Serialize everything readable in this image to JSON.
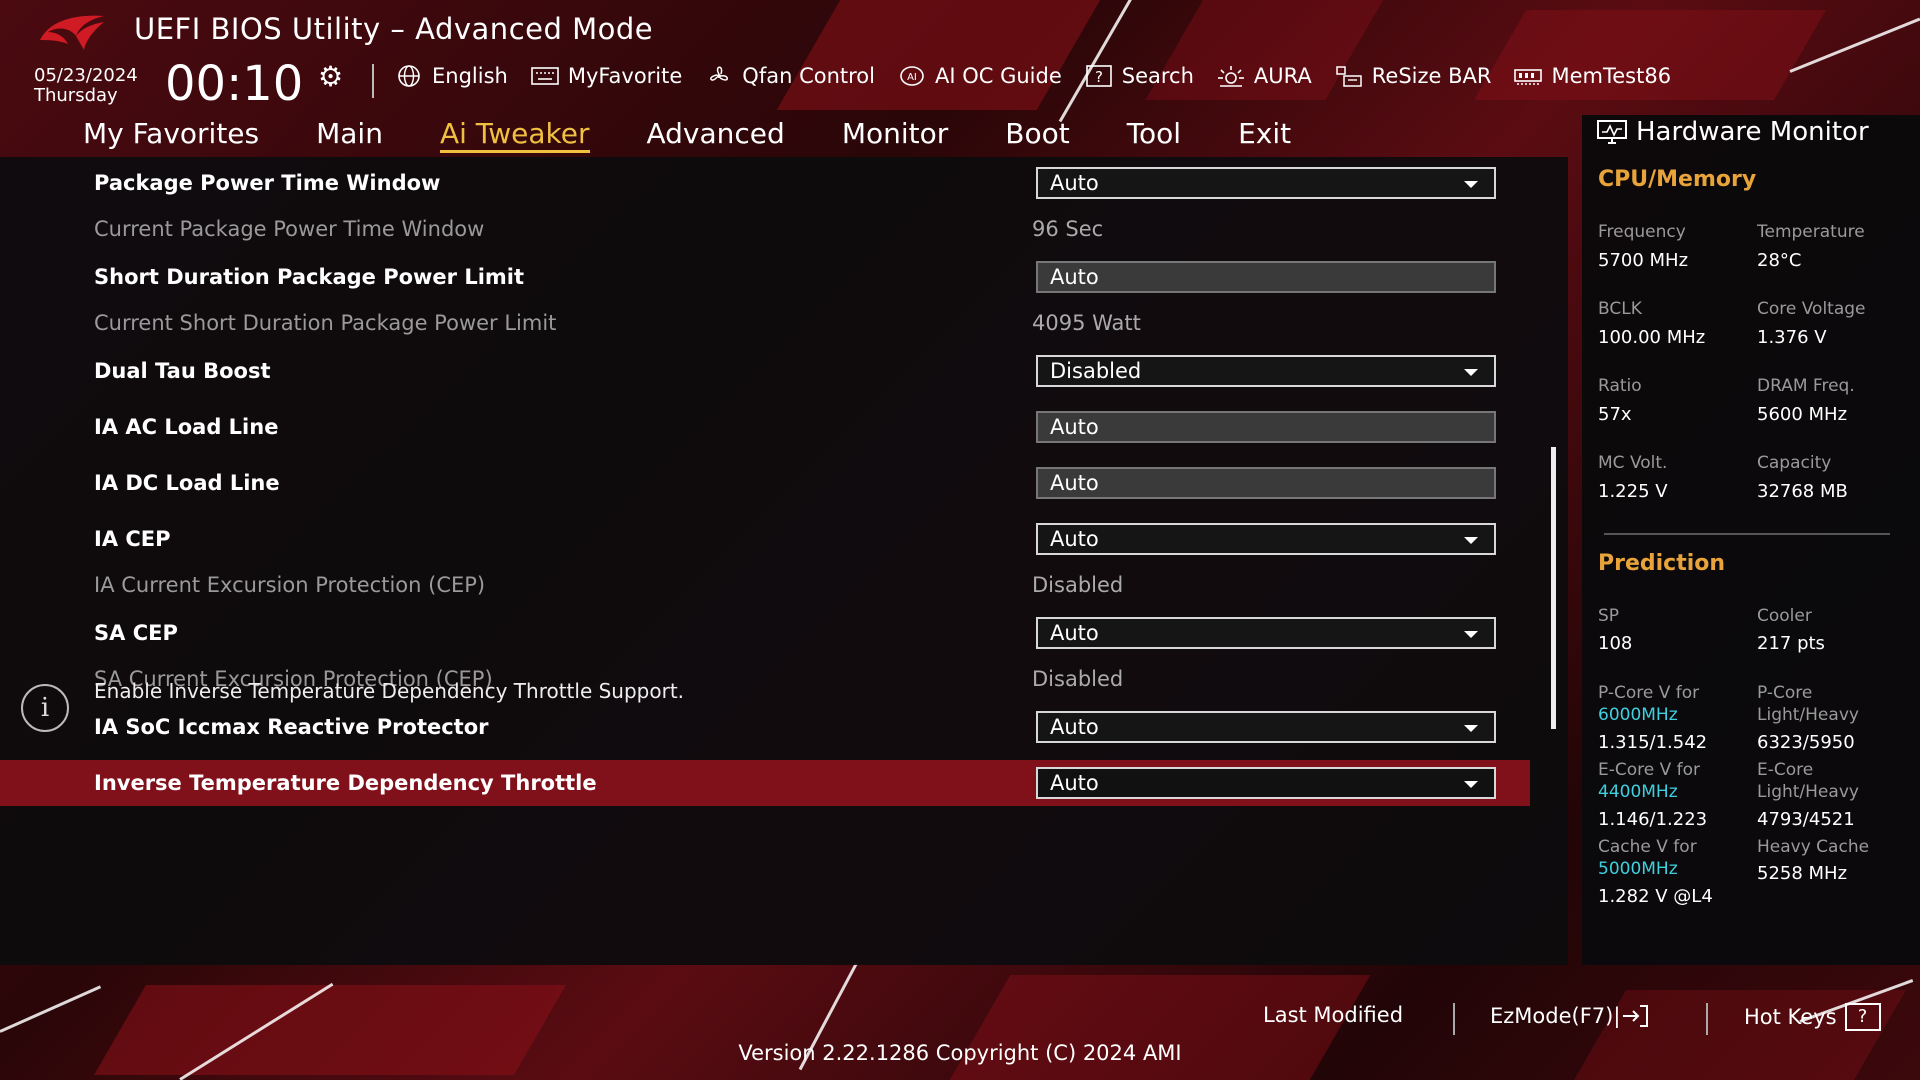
{
  "header": {
    "title": "UEFI BIOS Utility – Advanced Mode",
    "date": "05/23/2024",
    "day": "Thursday",
    "time": "00:10",
    "tools": [
      {
        "label": "English",
        "icon": "globe-icon"
      },
      {
        "label": "MyFavorite",
        "icon": "keyboard-icon"
      },
      {
        "label": "Qfan Control",
        "icon": "fan-icon"
      },
      {
        "label": "AI OC Guide",
        "icon": "ai-chip-icon"
      },
      {
        "label": "Search",
        "icon": "help-box-icon"
      },
      {
        "label": "AURA",
        "icon": "aura-icon"
      },
      {
        "label": "ReSize BAR",
        "icon": "resize-bar-icon"
      },
      {
        "label": "MemTest86",
        "icon": "memory-icon"
      }
    ]
  },
  "nav": {
    "tabs": [
      "My Favorites",
      "Main",
      "Ai Tweaker",
      "Advanced",
      "Monitor",
      "Boot",
      "Tool",
      "Exit"
    ],
    "active": "Ai Tweaker"
  },
  "settings": [
    {
      "label": "Package Power Time Window",
      "type": "dropdown",
      "value": "Auto"
    },
    {
      "label": "Current Package Power Time Window",
      "type": "info",
      "value": "96 Sec"
    },
    {
      "label": "Short Duration Package Power Limit",
      "type": "field",
      "value": "Auto"
    },
    {
      "label": "Current Short Duration Package Power Limit",
      "type": "info",
      "value": "4095 Watt"
    },
    {
      "label": "Dual Tau Boost",
      "type": "dropdown",
      "value": "Disabled"
    },
    {
      "label": "IA AC Load Line",
      "type": "field",
      "value": "Auto"
    },
    {
      "label": "IA DC Load Line",
      "type": "field",
      "value": "Auto"
    },
    {
      "label": "IA CEP",
      "type": "dropdown",
      "value": "Auto"
    },
    {
      "label": "IA Current Excursion Protection (CEP)",
      "type": "info",
      "value": "Disabled"
    },
    {
      "label": "SA CEP",
      "type": "dropdown",
      "value": "Auto"
    },
    {
      "label": "SA Current Excursion Protection (CEP)",
      "type": "info",
      "value": "Disabled"
    },
    {
      "label": "IA SoC Iccmax Reactive Protector",
      "type": "dropdown",
      "value": "Auto"
    },
    {
      "label": "Inverse Temperature Dependency Throttle",
      "type": "dropdown",
      "value": "Auto",
      "selected": true
    }
  ],
  "help": {
    "text": "Enable Inverse Temperature Dependency Throttle Support."
  },
  "hw_monitor": {
    "title": "Hardware Monitor",
    "cpu_section": "CPU/Memory",
    "cpu": {
      "frequency_label": "Frequency",
      "frequency": "5700 MHz",
      "temperature_label": "Temperature",
      "temperature": "28°C",
      "bclk_label": "BCLK",
      "bclk": "100.00 MHz",
      "core_voltage_label": "Core Voltage",
      "core_voltage": "1.376 V",
      "ratio_label": "Ratio",
      "ratio": "57x",
      "dram_freq_label": "DRAM Freq.",
      "dram_freq": "5600 MHz",
      "mc_volt_label": "MC Volt.",
      "mc_volt": "1.225 V",
      "capacity_label": "Capacity",
      "capacity": "32768 MB"
    },
    "prediction_section": "Prediction",
    "prediction": {
      "sp_label": "SP",
      "sp": "108",
      "cooler_label": "Cooler",
      "cooler": "217 pts",
      "pcore_v_label": "P-Core V for",
      "pcore_v_freq": "6000MHz",
      "pcore_v": "1.315/1.542",
      "pcore_lh_label1": "P-Core",
      "pcore_lh_label2": "Light/Heavy",
      "pcore_lh": "6323/5950",
      "ecore_v_label": "E-Core V for",
      "ecore_v_freq": "4400MHz",
      "ecore_v": "1.146/1.223",
      "ecore_lh_label1": "E-Core",
      "ecore_lh_label2": "Light/Heavy",
      "ecore_lh": "4793/4521",
      "cache_v_label": "Cache V for",
      "cache_v_freq": "5000MHz",
      "cache_v": "1.282 V @L4",
      "heavy_cache_label": "Heavy Cache",
      "heavy_cache": "5258 MHz"
    },
    "highlight_color": "#3fd0e0"
  },
  "footer": {
    "last_modified": "Last Modified",
    "ezmode": "EzMode(F7)|",
    "hotkeys": "Hot Keys",
    "hotkeys_key": "?",
    "version": "Version 2.22.1286 Copyright (C) 2024 AMI"
  },
  "colors": {
    "accent": "#f0c040",
    "selection": "#80101a",
    "section": "#e8a33a"
  }
}
